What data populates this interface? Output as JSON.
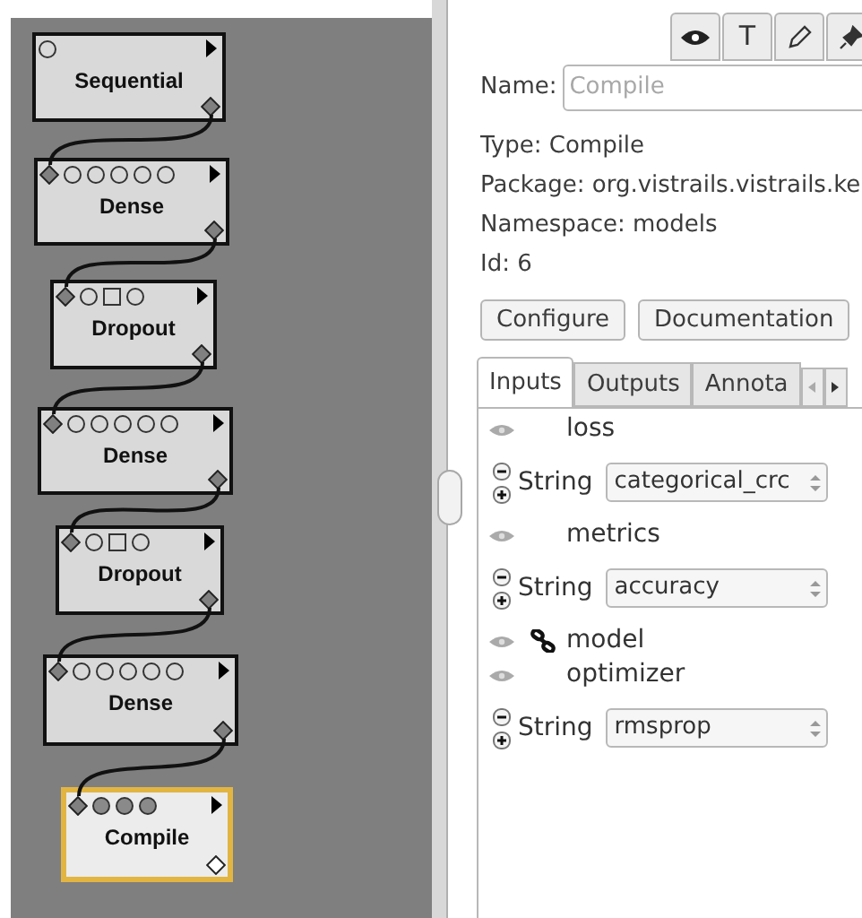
{
  "canvas": {
    "nodes": [
      {
        "label": "Sequential",
        "input_ports": [
          {
            "kind": "circle",
            "filled": false
          }
        ],
        "output_port": {
          "filled": true
        },
        "selected": false
      },
      {
        "label": "Dense",
        "input_ports": [
          {
            "kind": "diamond",
            "filled": true
          },
          {
            "kind": "circle",
            "filled": false
          },
          {
            "kind": "circle",
            "filled": false
          },
          {
            "kind": "circle",
            "filled": false
          },
          {
            "kind": "circle",
            "filled": false
          },
          {
            "kind": "circle",
            "filled": false
          }
        ],
        "output_port": {
          "filled": true
        },
        "selected": false
      },
      {
        "label": "Dropout",
        "input_ports": [
          {
            "kind": "diamond",
            "filled": true
          },
          {
            "kind": "circle",
            "filled": false
          },
          {
            "kind": "square",
            "filled": false
          },
          {
            "kind": "circle",
            "filled": false
          }
        ],
        "output_port": {
          "filled": true
        },
        "selected": false
      },
      {
        "label": "Dense",
        "input_ports": [
          {
            "kind": "diamond",
            "filled": true
          },
          {
            "kind": "circle",
            "filled": false
          },
          {
            "kind": "circle",
            "filled": false
          },
          {
            "kind": "circle",
            "filled": false
          },
          {
            "kind": "circle",
            "filled": false
          },
          {
            "kind": "circle",
            "filled": false
          }
        ],
        "output_port": {
          "filled": true
        },
        "selected": false
      },
      {
        "label": "Dropout",
        "input_ports": [
          {
            "kind": "diamond",
            "filled": true
          },
          {
            "kind": "circle",
            "filled": false
          },
          {
            "kind": "square",
            "filled": false
          },
          {
            "kind": "circle",
            "filled": false
          }
        ],
        "output_port": {
          "filled": true
        },
        "selected": false
      },
      {
        "label": "Dense",
        "input_ports": [
          {
            "kind": "diamond",
            "filled": true
          },
          {
            "kind": "circle",
            "filled": false
          },
          {
            "kind": "circle",
            "filled": false
          },
          {
            "kind": "circle",
            "filled": false
          },
          {
            "kind": "circle",
            "filled": false
          },
          {
            "kind": "circle",
            "filled": false
          }
        ],
        "output_port": {
          "filled": true
        },
        "selected": false
      },
      {
        "label": "Compile",
        "input_ports": [
          {
            "kind": "diamond",
            "filled": true
          },
          {
            "kind": "circle",
            "filled": true
          },
          {
            "kind": "circle",
            "filled": true
          },
          {
            "kind": "circle",
            "filled": true
          }
        ],
        "output_port": {
          "filled": false
        },
        "selected": true
      }
    ]
  },
  "inspector": {
    "toolbar": [
      {
        "kind": "eye"
      },
      {
        "kind": "text",
        "label": "T"
      },
      {
        "kind": "pencil"
      },
      {
        "kind": "pin"
      }
    ],
    "name": {
      "label": "Name:",
      "placeholder": "Compile"
    },
    "info": [
      "Type: Compile",
      "Package: org.vistrails.vistrails.ke",
      "Namespace: models",
      "Id: 6"
    ],
    "buttons": [
      "Configure",
      "Documentation"
    ],
    "tabs": [
      {
        "label": "Inputs",
        "selected": true
      },
      {
        "label": "Outputs",
        "selected": false
      },
      {
        "label": "Annota",
        "selected": false
      }
    ],
    "ports": [
      {
        "name": "loss",
        "linked": false,
        "values": [
          {
            "type": "String",
            "value": "categorical_crc"
          }
        ]
      },
      {
        "name": "metrics",
        "linked": false,
        "values": [
          {
            "type": "String",
            "value": "accuracy"
          }
        ]
      },
      {
        "name": "model",
        "linked": true
      },
      {
        "name": "optimizer",
        "linked": false,
        "values": [
          {
            "type": "String",
            "value": "rmsprop"
          }
        ]
      }
    ]
  }
}
